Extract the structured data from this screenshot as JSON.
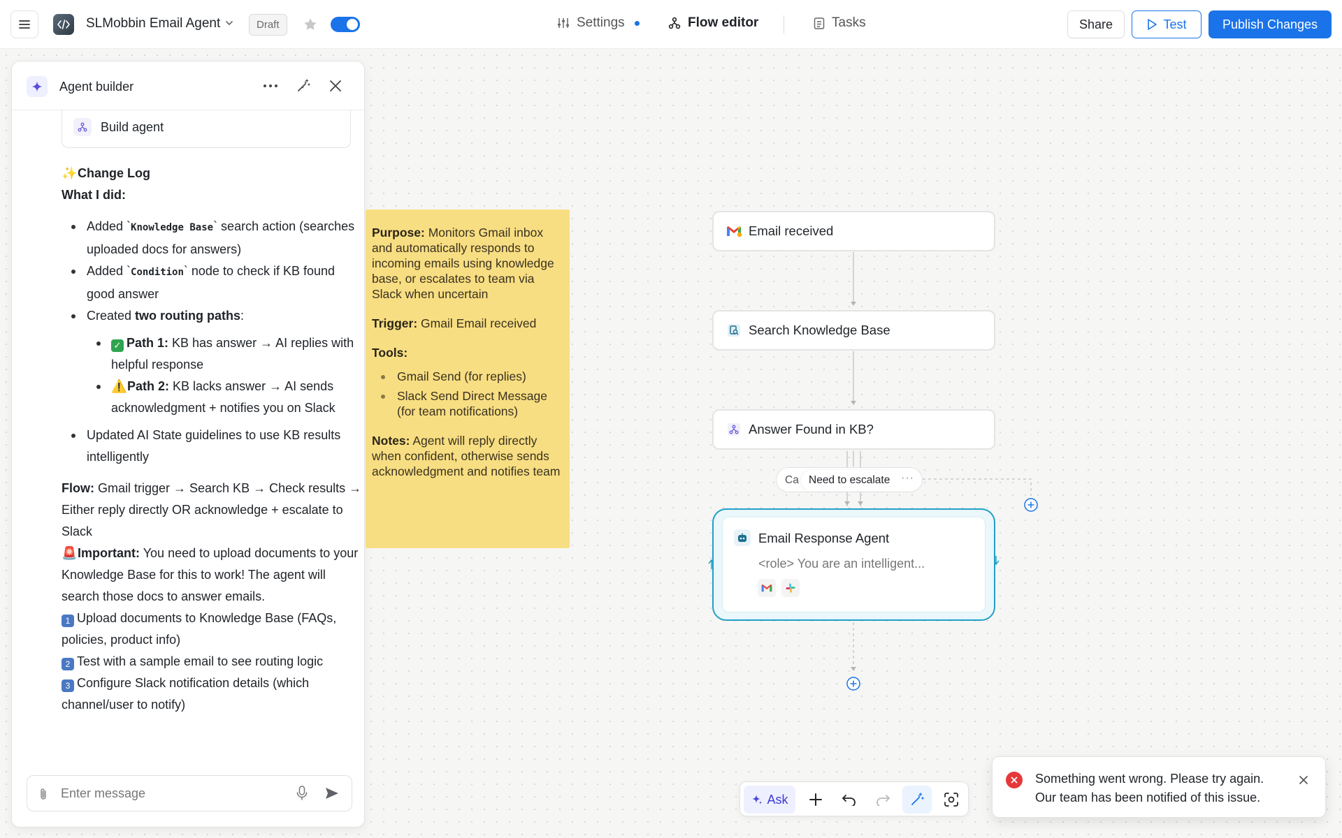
{
  "header": {
    "app_title": "SLMobbin Email Agent",
    "status_badge": "Draft",
    "toggle_on": true,
    "tabs": [
      {
        "label": "Settings",
        "has_dot": true
      },
      {
        "label": "Flow editor",
        "active": true
      },
      {
        "label": "Tasks"
      }
    ],
    "share_label": "Share",
    "test_label": "Test",
    "publish_label": "Publish Changes"
  },
  "panel": {
    "title": "Agent builder",
    "build_card_label": "Build agent",
    "change_log": {
      "heading_emoji": "✨",
      "heading": "Change Log",
      "what_i_did": "What I did:",
      "items": [
        {
          "pre": "Added `",
          "code": "Knowledge Base",
          "post": "` search action (searches uploaded docs for answers)"
        },
        {
          "pre": "Added `",
          "code": "Condition",
          "post": "` node to check if KB found good answer"
        }
      ],
      "routing_pre": "Created ",
      "routing_bold": "two routing paths",
      "routing_post": ":",
      "paths": [
        {
          "emoji": "✓",
          "label": "Path 1:",
          "text": " KB has answer → AI replies with helpful response"
        },
        {
          "emoji": "⚠️",
          "label": "Path 2:",
          "text": " KB lacks answer → AI sends acknowledgment + notifies you on Slack"
        }
      ],
      "updated_item": "Updated AI State guidelines to use KB results intelligently",
      "flow_label": "Flow:",
      "flow_text": " Gmail trigger → Search KB → Check results → Either reply directly OR acknowledge + escalate to Slack",
      "important_emoji": "🚨",
      "important_label": "Important:",
      "important_text": " You need to upload documents to your Knowledge Base for this to work! The agent will search those docs to answer emails.",
      "steps": [
        {
          "num": "1",
          "text": "Upload documents to Knowledge Base (FAQs, policies, product info)"
        },
        {
          "num": "2",
          "text": "Test with a sample email to see routing logic"
        },
        {
          "num": "3",
          "text": "Configure Slack notification details (which channel/user to notify)"
        }
      ]
    },
    "message_placeholder": "Enter message"
  },
  "note": {
    "purpose_label": "Purpose:",
    "purpose_text": " Monitors Gmail inbox and automatically responds to incoming emails using knowledge base, or escalates to team via Slack when uncertain",
    "trigger_label": "Trigger:",
    "trigger_text": " Gmail Email received",
    "tools_label": "Tools:",
    "tools": [
      "Gmail Send (for replies)",
      "Slack Send Direct Message (for team notifications)"
    ],
    "notes_label": "Notes:",
    "notes_text": " Agent will reply directly when confident, otherwise sends acknowledgment and notifies team"
  },
  "flow": {
    "nodes": [
      {
        "label": "Email received",
        "icon": "gmail-icon"
      },
      {
        "label": "Search Knowledge Base",
        "icon": "knowledge-base-icon"
      },
      {
        "label": "Answer Found in KB?",
        "icon": "branch-icon"
      }
    ],
    "edge_label_peek": "Ca",
    "edge_label": "Need to escalate",
    "edge_label_more": "···",
    "agent": {
      "title": "Email Response Agent",
      "role_preview": "<role> You are an intelligent...",
      "tools": [
        "gmail-icon",
        "slack-icon"
      ]
    }
  },
  "toolbar": {
    "ask_label": "Ask"
  },
  "toast": {
    "line1": "Something went wrong. Please try again.",
    "line2": "Our team has been notified of this issue."
  },
  "colors": {
    "primary": "#1a73e8",
    "note_bg": "#f8de82",
    "agent_border": "#22a0c7",
    "error": "#e5383b"
  }
}
